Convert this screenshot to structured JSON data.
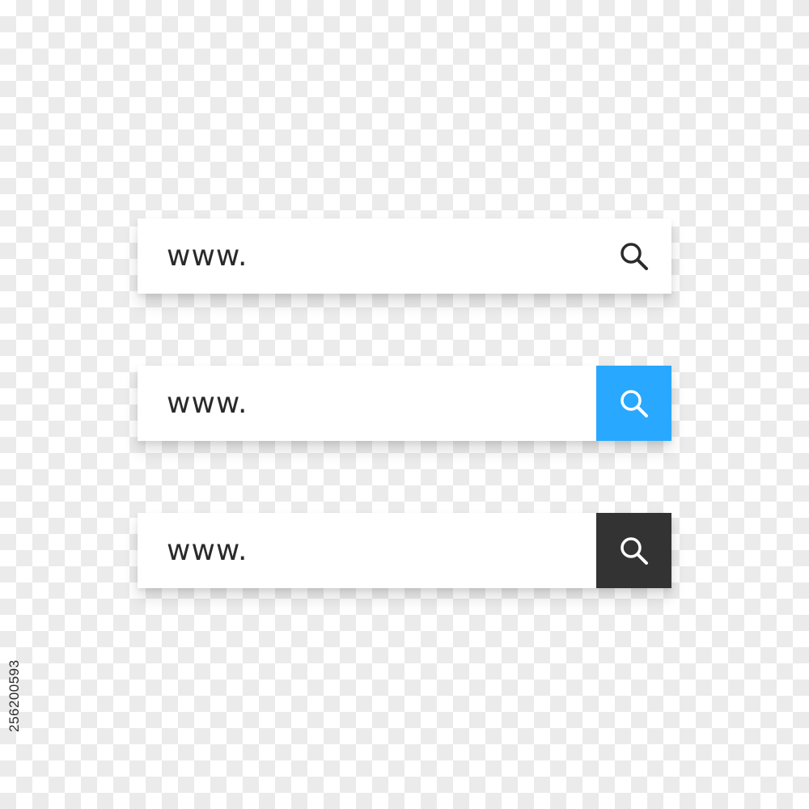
{
  "search_bars": [
    {
      "url_text": "www.",
      "button_style": "plain",
      "button_bg": "#ffffff",
      "icon_color": "#2b2b2b",
      "icon": "search-icon"
    },
    {
      "url_text": "www.",
      "button_style": "filled",
      "button_bg": "#29a8ff",
      "icon_color": "#ffffff",
      "icon": "search-icon"
    },
    {
      "url_text": "www.",
      "button_style": "filled",
      "button_bg": "#333333",
      "icon_color": "#ffffff",
      "icon": "search-icon"
    }
  ],
  "watermark": {
    "stock_id": "256200593"
  },
  "colors": {
    "checker_light": "#ffffff",
    "checker_dark": "#ebebeb",
    "text": "#2a2a2a"
  }
}
